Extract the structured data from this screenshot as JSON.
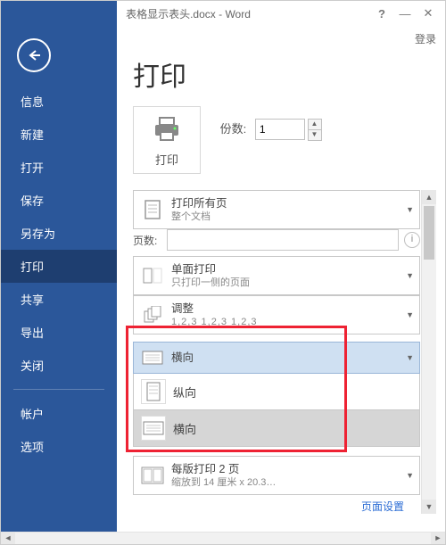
{
  "window": {
    "title": "表格显示表头.docx - Word",
    "help": "?",
    "min": "—",
    "close": "✕",
    "login": "登录"
  },
  "sidebar": {
    "back_name": "back",
    "items": [
      "信息",
      "新建",
      "打开",
      "保存",
      "另存为",
      "打印",
      "共享",
      "导出",
      "关闭"
    ],
    "selected": 5,
    "footer": [
      "帐户",
      "选项"
    ]
  },
  "print": {
    "heading": "打印",
    "button_label": "打印",
    "copies_label": "份数:",
    "copies_value": "1"
  },
  "settings": {
    "print_all": {
      "t1": "打印所有页",
      "t2": "整个文档"
    },
    "pages_label": "页数:",
    "pages_value": "",
    "one_sided": {
      "t1": "单面打印",
      "t2": "只打印一侧的页面"
    },
    "collate": {
      "t1": "调整",
      "t2": "1,2,3   1,2,3   1,2,3"
    },
    "orientation": {
      "selected": "横向",
      "options": [
        "纵向",
        "横向"
      ]
    },
    "pps": {
      "t1": "每版打印 2 页",
      "t2": "缩放到 14 厘米 x 20.3…"
    },
    "page_setup": "页面设置"
  },
  "icons": {
    "printer": "printer-icon",
    "page": "page-icon",
    "duplex": "duplex-icon",
    "collate": "collate-icon",
    "portrait": "portrait-icon",
    "landscape": "landscape-icon",
    "pps": "pps-icon",
    "info": "info-icon"
  }
}
